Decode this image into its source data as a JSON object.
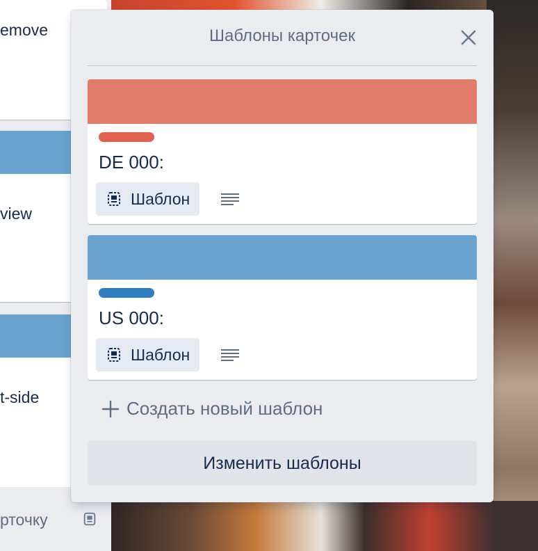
{
  "popover": {
    "title": "Шаблоны карточек",
    "close_icon": "close-icon",
    "templates": [
      {
        "cover_color": "#e17b6a",
        "label_color": "#e0624e",
        "title": "DE 000:",
        "badge_label": "Шаблон",
        "badge_icon": "template-card-icon",
        "description_icon": "description-icon"
      },
      {
        "cover_color": "#6aa3cd",
        "label_color": "#2f7dbd",
        "title": "US 000:",
        "badge_label": "Шаблон",
        "badge_icon": "template-card-icon",
        "description_icon": "description-icon"
      }
    ],
    "create_new_label": "Создать новый шаблон",
    "edit_button_label": "Изменить шаблоны"
  },
  "background_list": {
    "cards": [
      {
        "text": "emove"
      },
      {
        "text": "view",
        "cover_color": "#6aa3cd"
      },
      {
        "text": "t-side",
        "cover_color": "#6aa3cd"
      }
    ],
    "add_card_label": "рточку",
    "add_card_icon": "template-card-icon"
  }
}
